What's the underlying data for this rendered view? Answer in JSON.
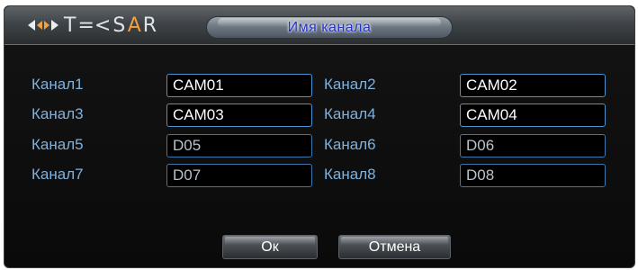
{
  "title_bar": {
    "brand": "TESSAR",
    "title": "Имя канала"
  },
  "channels": [
    {
      "label": "Канал1",
      "value": "CAM01"
    },
    {
      "label": "Канал2",
      "value": "CAM02"
    },
    {
      "label": "Канал3",
      "value": "CAM03"
    },
    {
      "label": "Канал4",
      "value": "CAM04"
    },
    {
      "label": "Канал5",
      "value": "D05"
    },
    {
      "label": "Канал6",
      "value": "D06"
    },
    {
      "label": "Канал7",
      "value": "D07"
    },
    {
      "label": "Канал8",
      "value": "D08"
    }
  ],
  "buttons": {
    "ok": "Ок",
    "cancel": "Отмена"
  },
  "colors": {
    "label": "#7fb1dd",
    "field_border": "#4b92cf",
    "title_text": "#2233cc",
    "brand_accent": "#f0a040"
  }
}
